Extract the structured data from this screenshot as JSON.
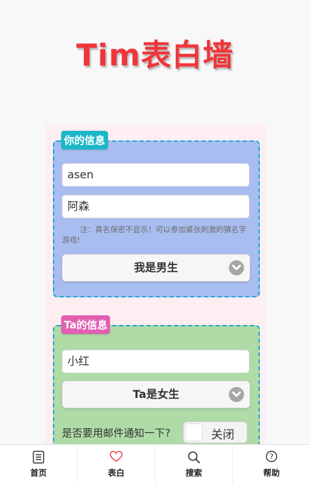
{
  "app": {
    "title": "Tim表白墙"
  },
  "my_info": {
    "badge": "你的信息",
    "name_value": "asen",
    "realname_value": "阿森",
    "note": "注：真名保密不显示！可以参加紧张刺激的猜名字游戏!",
    "gender_select": "我是男生"
  },
  "ta_info": {
    "badge": "Ta的信息",
    "name_value": "小红",
    "gender_select": "Ta是女生",
    "notify_label": "是否要用邮件通知一下?",
    "notify_toggle": "关闭"
  },
  "tabbar": {
    "items": [
      {
        "label": "首页",
        "icon": "document-icon"
      },
      {
        "label": "表白",
        "icon": "heart-icon"
      },
      {
        "label": "搜索",
        "icon": "search-icon"
      },
      {
        "label": "帮助",
        "icon": "help-icon"
      }
    ]
  },
  "colors": {
    "title": "#f0353a",
    "my_box_bg": "#a9bef0",
    "ta_box_bg": "#afdba7",
    "my_badge": "#18b8c9",
    "ta_badge": "#e25fb1",
    "dashed_border": "#1ea7d6",
    "heart": "#f0353a"
  }
}
